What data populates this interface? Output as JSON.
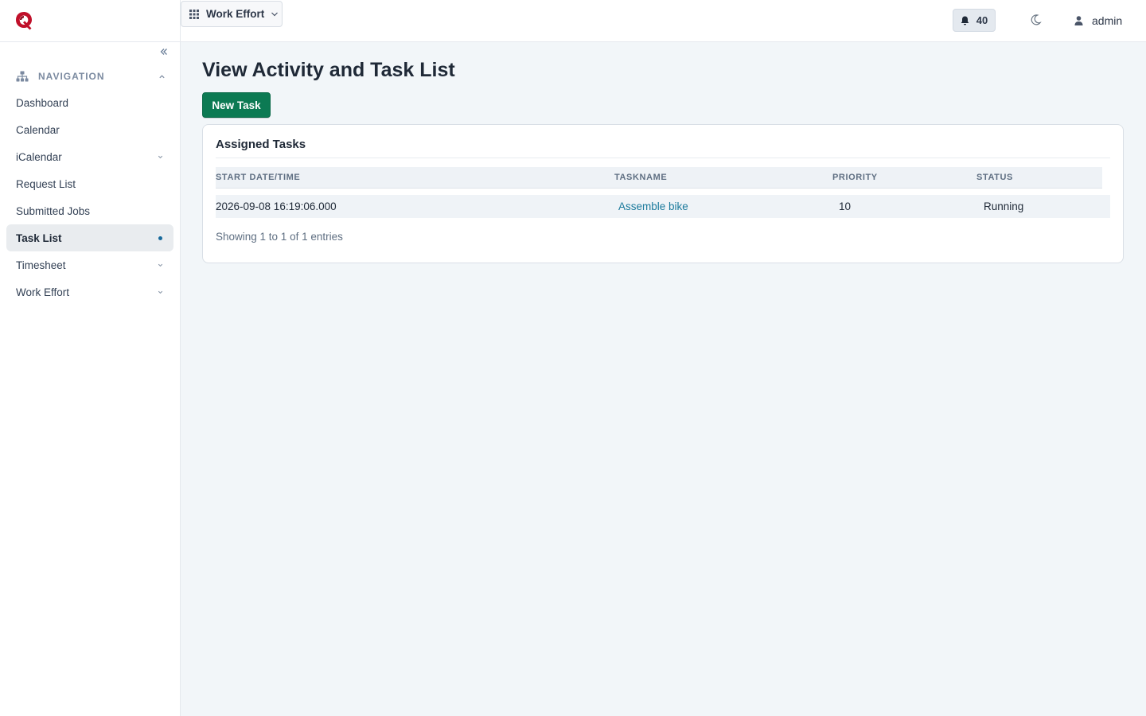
{
  "app": {
    "module_switcher_label": "Work Effort",
    "notifications_count": "40",
    "username": "admin"
  },
  "sidebar": {
    "section_label": "NAVIGATION",
    "items": [
      {
        "label": "Dashboard"
      },
      {
        "label": "Calendar"
      },
      {
        "label": "iCalendar"
      },
      {
        "label": "Request List"
      },
      {
        "label": "Submitted Jobs"
      },
      {
        "label": "Task List"
      },
      {
        "label": "Timesheet"
      },
      {
        "label": "Work Effort"
      }
    ]
  },
  "main": {
    "page_title": "View Activity and Task List",
    "new_task_label": "New Task",
    "card_title": "Assigned Tasks",
    "table": {
      "columns": [
        "START DATE/TIME",
        "TASKNAME",
        "PRIORITY",
        "STATUS"
      ],
      "rows": [
        {
          "start": "2026-09-08 16:19:06.000",
          "taskname": "Assemble bike",
          "priority": "10",
          "status": "Running"
        }
      ]
    },
    "entries_info": "Showing 1 to 1 of 1 entries"
  },
  "colors": {
    "brand": "#c0102a",
    "primary_button": "#0c7a53",
    "link": "#1b7a9c",
    "active_dot": "#17699b"
  },
  "icons": {
    "logo": "app-logo",
    "collapse": "double-chevron-left-icon",
    "navigation": "sitemap-icon",
    "apps": "grid-icon",
    "notifications": "bell-icon",
    "theme": "moon-icon",
    "user": "user-icon"
  }
}
